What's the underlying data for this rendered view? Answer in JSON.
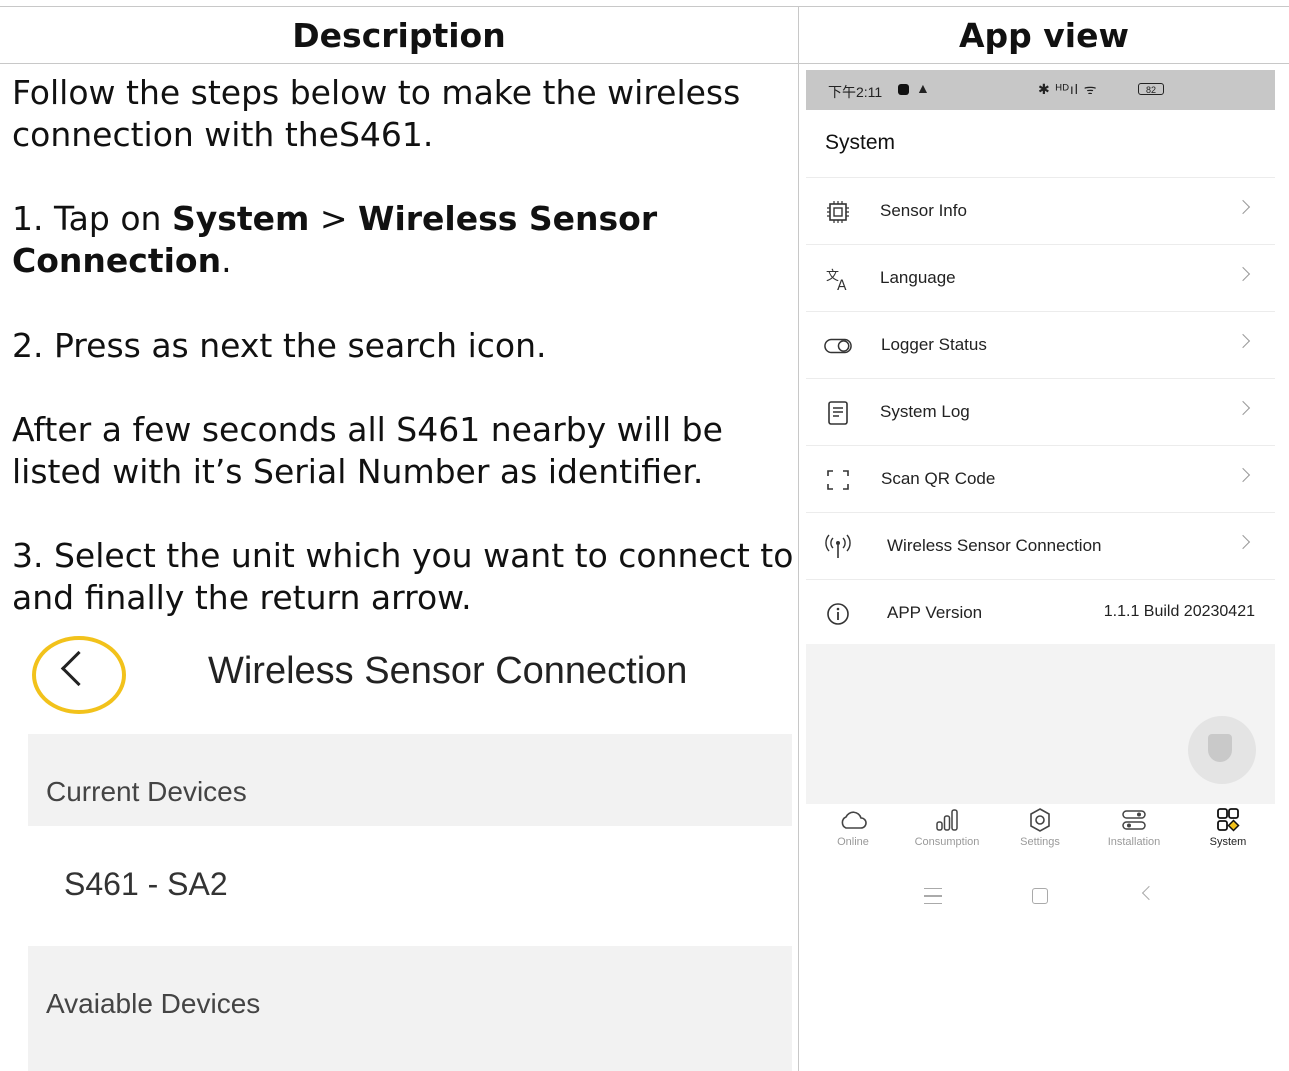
{
  "table": {
    "header_left": "Description",
    "header_right": "App view"
  },
  "description": {
    "intro": "Follow the steps below to make the wireless connection with theS461.",
    "step1_prefix": "1. Tap on ",
    "step1_bold1": "System",
    "step1_sep": " > ",
    "step1_bold2": "Wireless Sensor Connection",
    "step1_suffix": ".",
    "step2": "2. Press as next the search icon.",
    "after": "After a few seconds all S461 nearby will be listed with it’s Serial Number as identifier.",
    "step3": "3. Select the unit which you want to connect to and finally the return arrow."
  },
  "inset": {
    "title": "Wireless Sensor Connection",
    "current_section": "Current Devices",
    "current_device": "S461 - SA2",
    "available_section": "Avaiable Devices",
    "highlight_color": "#f2c21b"
  },
  "phone": {
    "status": {
      "time": "下午2:11",
      "right_icons": "✱ ᴴᴰıl ᯤ",
      "battery": "82"
    },
    "title": "System",
    "rows": [
      {
        "icon": "sensor-chip-icon",
        "label": "Sensor Info"
      },
      {
        "icon": "translate-icon",
        "label": "Language"
      },
      {
        "icon": "toggle-icon",
        "label": "Logger Status"
      },
      {
        "icon": "document-icon",
        "label": "System Log"
      },
      {
        "icon": "scan-icon",
        "label": "Scan QR Code"
      },
      {
        "icon": "wireless-icon",
        "label": "Wireless Sensor Connection"
      },
      {
        "icon": "info-icon",
        "label": "APP Version",
        "value": "1.1.1 Build 20230421"
      }
    ],
    "nav": [
      {
        "icon": "cloud-icon",
        "label": "Online"
      },
      {
        "icon": "bar-chart-icon",
        "label": "Consumption"
      },
      {
        "icon": "gear-icon",
        "label": "Settings"
      },
      {
        "icon": "installation-icon",
        "label": "Installation"
      },
      {
        "icon": "system-grid-icon",
        "label": "System",
        "active": true
      }
    ]
  }
}
